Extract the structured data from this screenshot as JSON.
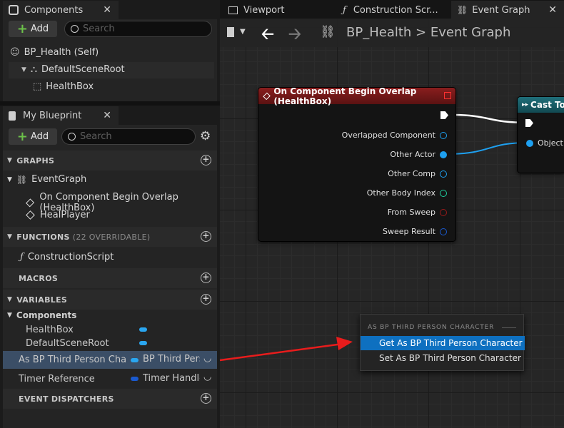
{
  "left_panel": {
    "components": {
      "tab_label": "Components",
      "add_label": "Add",
      "search_placeholder": "Search",
      "tree": [
        {
          "label": "BP_Health (Self)"
        },
        {
          "label": "DefaultSceneRoot"
        },
        {
          "label": "HealthBox"
        }
      ]
    },
    "my_blueprint": {
      "tab_label": "My Blueprint",
      "add_label": "Add",
      "search_placeholder": "Search",
      "sections": {
        "graphs": "GRAPHS",
        "functions": "FUNCTIONS",
        "functions_sub": "(22 OVERRIDABLE)",
        "macros": "MACROS",
        "variables": "VARIABLES",
        "event_dispatchers": "EVENT DISPATCHERS"
      },
      "graph_items": [
        "EventGraph",
        "On Component Begin Overlap (HealthBox)",
        "HealPlayer"
      ],
      "function_items": [
        "ConstructionScript"
      ],
      "variable_category": "Components",
      "variables": [
        {
          "name": "HealthBox"
        },
        {
          "name": "DefaultSceneRoot"
        },
        {
          "name": "As BP Third Person Chara",
          "type": "BP Third Pers"
        },
        {
          "name": "Timer Reference",
          "type": "Timer Handle"
        }
      ]
    }
  },
  "editor_tabs": [
    {
      "label": "Viewport",
      "icon": "viewport-icon"
    },
    {
      "label": "Construction Scr...",
      "icon": "function-icon"
    },
    {
      "label": "Event Graph",
      "icon": "event-graph-icon",
      "active": true
    }
  ],
  "breadcrumb": {
    "blueprint": "BP_Health",
    "separator": ">",
    "graph": "Event Graph"
  },
  "overlap_node": {
    "title": "On Component Begin Overlap (HealthBox)",
    "pins": [
      "Overlapped Component",
      "Other Actor",
      "Other Comp",
      "Other Body Index",
      "From Sweep",
      "Sweep Result"
    ]
  },
  "cast_node": {
    "title": "Cast To",
    "pins": [
      "Object"
    ]
  },
  "context_menu": {
    "header": "AS BP THIRD PERSON CHARACTER",
    "items": [
      "Get As BP Third Person Character",
      "Set As BP Third Person Character"
    ],
    "selected_index": 0
  },
  "colors": {
    "object_pin": "#1ea0f0",
    "int_pin": "#1fcf9f",
    "bool_pin": "#9a1a1a",
    "struct_pin": "#1a5ad0",
    "event_header": "#7a1a1a",
    "selection": "#0e70c0",
    "annotation_arrow": "#e81c1c"
  }
}
